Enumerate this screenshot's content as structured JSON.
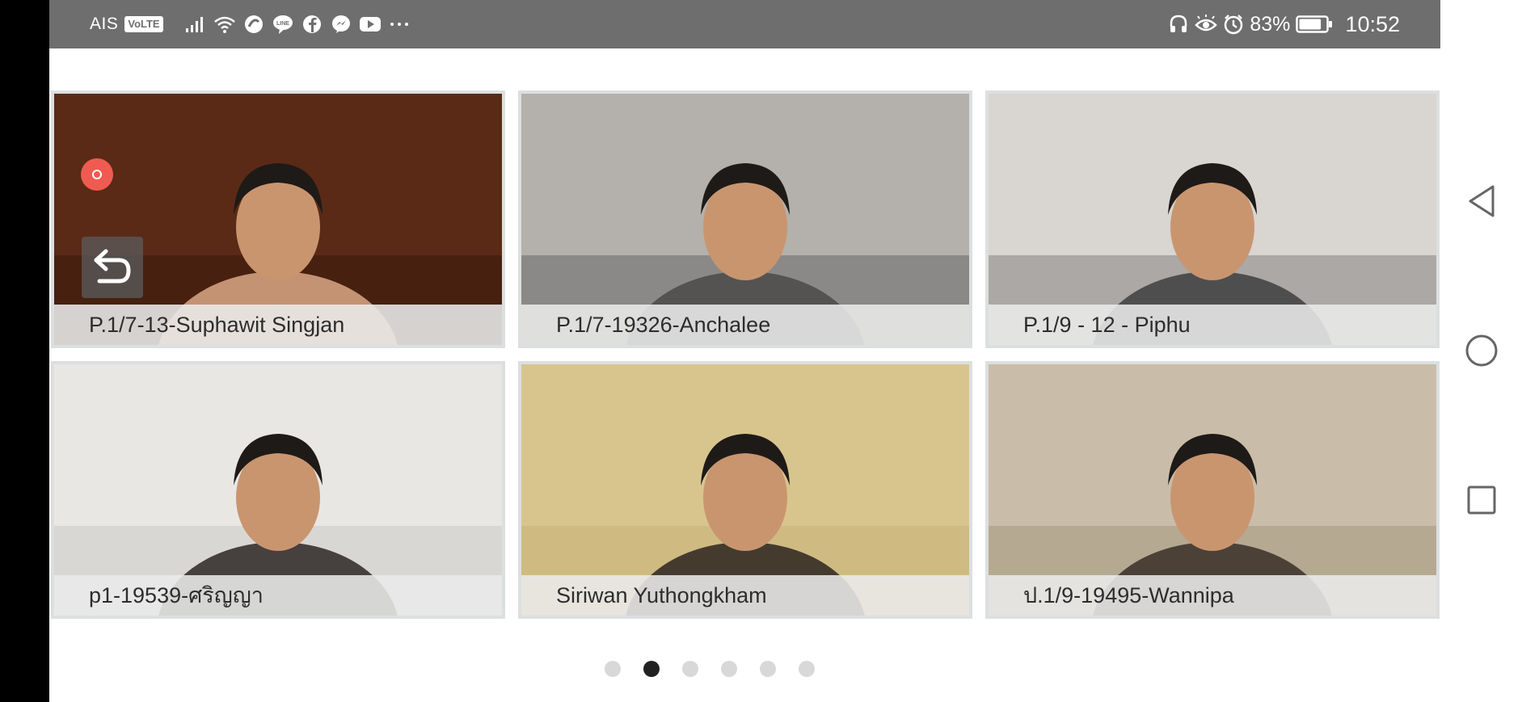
{
  "status_bar": {
    "carrier": "AIS",
    "network_badge": "VoLTE",
    "left_icons": [
      "signal-icon",
      "wifi-icon",
      "app-icon",
      "line-icon",
      "facebook-icon",
      "messenger-icon",
      "youtube-icon",
      "more-icon"
    ],
    "right_icons": [
      "headphones-icon",
      "eye-icon",
      "alarm-icon",
      "battery-icon"
    ],
    "battery_percent": "83%",
    "battery_level": 0.83,
    "time": "10:52"
  },
  "participants": [
    {
      "name": "P.1/7-13-Suphawit  Singjan",
      "wall": "#5a2a16",
      "floor": "#3a1a0c",
      "person": "#d9a886"
    },
    {
      "name": "P.1/7-19326-Anchalee",
      "wall": "#b4b0ab",
      "floor": "#6f6f6f",
      "person": "#4a4a48"
    },
    {
      "name": "P.1/9 - 12 - Piphu",
      "wall": "#d9d5d0",
      "floor": "#8d8b88",
      "person": "#3e3e3e"
    },
    {
      "name": "p1-19539-ศริญญา",
      "wall": "#e9e7e4",
      "floor": "#cfcdca",
      "person": "#2b2623"
    },
    {
      "name": "Siriwan Yuthongkham",
      "wall": "#d8c58e",
      "floor": "#c9b47a",
      "person": "#2b2520"
    },
    {
      "name": "ป.1/9-19495-Wannipa",
      "wall": "#c9bda9",
      "floor": "#a99b84",
      "person": "#3a2f27"
    }
  ],
  "overlay_controls": [
    "record-indicator",
    "back-button"
  ],
  "pager": {
    "page_count": 6,
    "current_page": 2
  },
  "nav_bar": [
    "back-nav",
    "home-nav",
    "recents-nav"
  ],
  "colors": {
    "status_bar_bg": "#6e6e6e",
    "record_red": "#ef5b50",
    "tile_border": "#dcdfe0",
    "active_dot": "#222222",
    "inactive_dot": "#d8d8d8"
  }
}
